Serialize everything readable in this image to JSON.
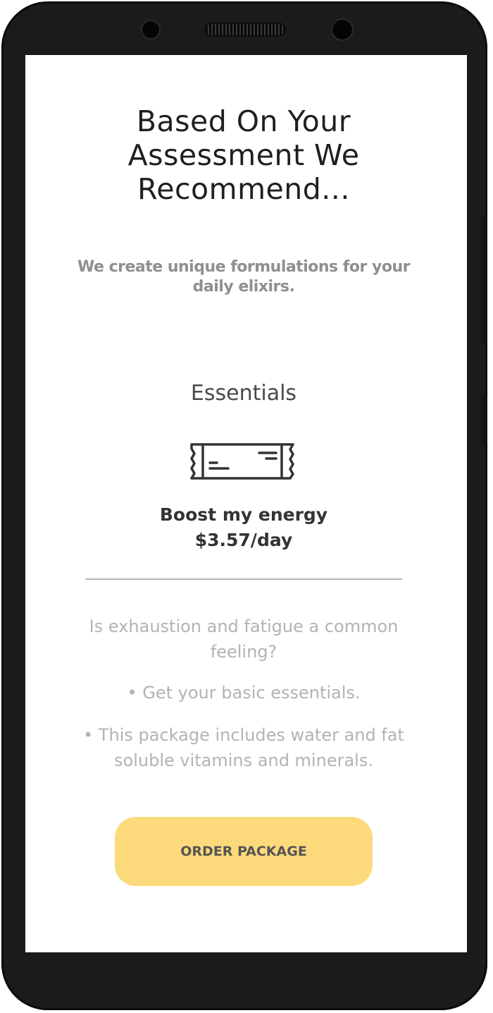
{
  "header": {
    "title_line1": "Based On Your",
    "title_line2": "Assessment We",
    "title_line3": "Recommend...",
    "subtitle_line1": "We create unique formulations for your",
    "subtitle_line2": "daily elixirs."
  },
  "package": {
    "name": "Essentials",
    "icon": "snack-bar-icon",
    "benefit": "Boost my energy",
    "price": "$3.57/day"
  },
  "description": {
    "question_line1": "Is exhaustion and fatigue a common",
    "question_line2": "feeling?",
    "bullet1": "• Get your basic essentials.",
    "bullet2_line1": "• This package includes water and fat",
    "bullet2_line2": "soluble vitamins and minerals."
  },
  "actions": {
    "order_label": "ORDER PACKAGE"
  },
  "colors": {
    "accent": "#fcd97b",
    "device_frame": "#1b1b1b",
    "title_text": "#1f1f1f",
    "muted_text": "#b3b3b3"
  }
}
